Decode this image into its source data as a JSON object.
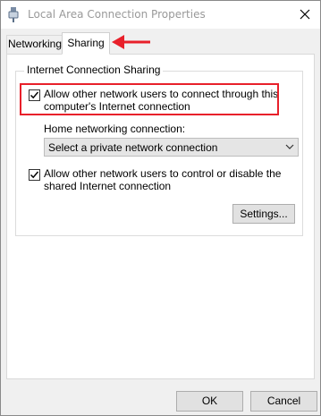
{
  "window": {
    "title": "Local Area Connection Properties"
  },
  "tabs": [
    {
      "label": "Networking",
      "active": false
    },
    {
      "label": "Sharing",
      "active": true
    }
  ],
  "sharing": {
    "group_title": "Internet Connection Sharing",
    "allow_connect": {
      "checked": true,
      "label": "Allow other network users to connect through this computer's Internet connection"
    },
    "home_networking": {
      "label": "Home networking connection:",
      "selected": "Select a private network connection"
    },
    "allow_control": {
      "checked": true,
      "label": "Allow other network users to control or disable the shared Internet connection"
    },
    "settings_button": "Settings..."
  },
  "footer": {
    "ok_label": "OK",
    "cancel_label": "Cancel"
  },
  "colors": {
    "annotation": "#e8202a",
    "dialog_bg": "#f0f0f0",
    "panel_bg": "#ffffff"
  },
  "icons": {
    "title": "network-adapter-icon",
    "close": "close-icon",
    "dropdown": "chevron-down-icon",
    "check": "checkmark-icon",
    "annotation": "arrow-left-icon"
  }
}
